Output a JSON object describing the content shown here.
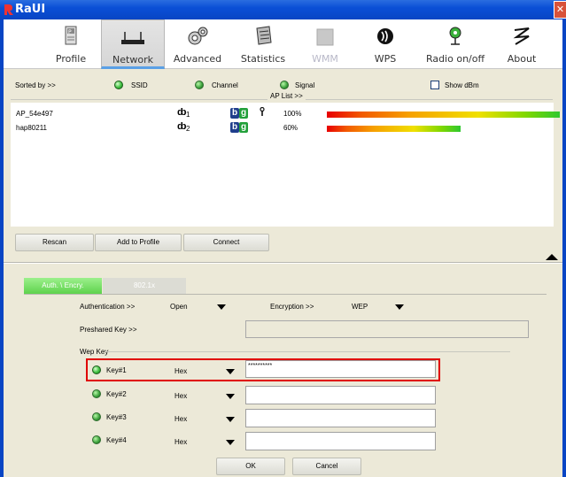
{
  "window": {
    "title": "RaUI",
    "close_glyph": "✕"
  },
  "toolbar": {
    "items": [
      {
        "label": "Profile",
        "icon": "profile-icon"
      },
      {
        "label": "Network",
        "icon": "network-icon"
      },
      {
        "label": "Advanced",
        "icon": "advanced-icon"
      },
      {
        "label": "Statistics",
        "icon": "statistics-icon"
      },
      {
        "label": "WMM",
        "icon": "wmm-icon"
      },
      {
        "label": "WPS",
        "icon": "wps-icon"
      },
      {
        "label": "Radio on/off",
        "icon": "radio-icon"
      },
      {
        "label": "About",
        "icon": "about-icon"
      }
    ]
  },
  "sort": {
    "label": "Sorted by >>",
    "ssid": "SSID",
    "channel": "Channel",
    "signal": "Signal",
    "show_dbm": "Show dBm",
    "selected": "SSID"
  },
  "ap_list": {
    "title": "AP List >>",
    "rows": [
      {
        "ssid": "AP_54e497",
        "channel": "1",
        "channel_glyph": "ȸ",
        "b": "b",
        "g": "g",
        "secure": true,
        "signal_text": "100%",
        "signal": 100
      },
      {
        "ssid": "hap80211",
        "channel": "2",
        "channel_glyph": "ȸ",
        "b": "b",
        "g": "g",
        "secure": false,
        "signal_text": "60%",
        "signal": 60
      }
    ]
  },
  "actions": {
    "rescan": "Rescan",
    "add_to_profile": "Add to Profile",
    "connect": "Connect"
  },
  "tabs": {
    "auth": "Auth. \\ Encry.",
    "dot1x": "802.1x"
  },
  "auth": {
    "auth_label": "Authentication >>",
    "auth_value": "Open",
    "enc_label": "Encryption >>",
    "enc_value": "WEP",
    "psk_label": "Preshared Key >>",
    "psk_value": ""
  },
  "wep": {
    "title": "Wep Key",
    "keys": [
      {
        "label": "Key#1",
        "format": "Hex",
        "value": "**********",
        "selected": true
      },
      {
        "label": "Key#2",
        "format": "Hex",
        "value": "",
        "selected": false
      },
      {
        "label": "Key#3",
        "format": "Hex",
        "value": "",
        "selected": false
      },
      {
        "label": "Key#4",
        "format": "Hex",
        "value": "",
        "selected": false
      }
    ]
  },
  "footer": {
    "ok": "OK",
    "cancel": "Cancel"
  },
  "colors": {
    "titlebar": "#0845c4",
    "tab_active": "#5ed24c",
    "highlight": "#e00000"
  }
}
